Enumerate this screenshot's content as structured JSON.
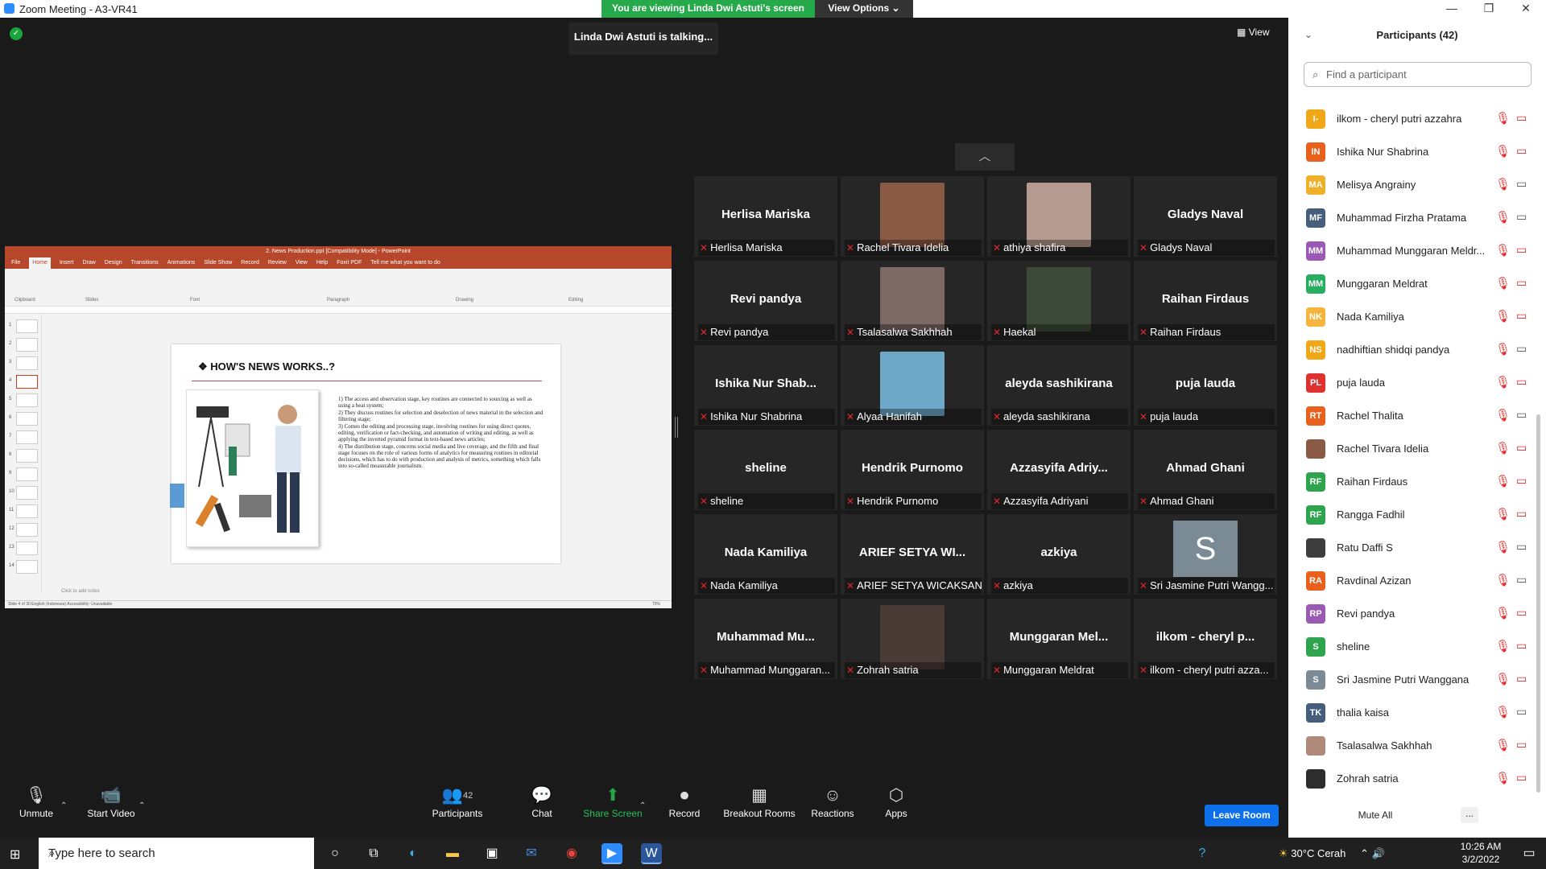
{
  "window": {
    "title": "Zoom Meeting - A3-VR41"
  },
  "banner": {
    "text": "You are viewing Linda Dwi Astuti's screen",
    "view_options": "View Options"
  },
  "talking": "Linda Dwi Astuti is talking...",
  "view_button": "View",
  "shared_screen": {
    "window_title": "2. News Production.ppt [Compatibility Mode] - PowerPoint",
    "tabs": [
      "File",
      "Home",
      "Insert",
      "Draw",
      "Design",
      "Transitions",
      "Animations",
      "Slide Show",
      "Record",
      "Review",
      "View",
      "Help",
      "Foxit PDF",
      "Tell me what you want to do"
    ],
    "ribbon_groups": [
      "Clipboard",
      "Slides",
      "Font",
      "Paragraph",
      "Drawing",
      "Editing"
    ],
    "slide_title": "HOW'S NEWS WORKS..?",
    "slide_points": [
      "1) The access and observation stage, key routines are connected to sourcing as well as using a beat system;",
      "2) They discuss routines for selection and deselection of news material in the selection and filtering stage;",
      "3) Comes the editing and processing stage, involving routines for using direct quotes, editing, verification or fact-checking, and automation of writing and editing, as well as applying the inverted pyramid format in text-based news articles;",
      "4) The distribution stage, concerns social media and live coverage, and the fifth and final stage focuses on the role of various forms of analytics for measuring routines in editorial decisions, which has to do with production and analysis of metrics, something which falls into so-called measurable journalism."
    ],
    "thumbnail_numbers": [
      "1",
      "2",
      "3",
      "4",
      "5",
      "6",
      "7",
      "8",
      "9",
      "10",
      "11",
      "12",
      "13",
      "14"
    ],
    "notes_placeholder": "Click to add notes",
    "status": "Slide 4 of 30    English (Indonesia)    Accessibility: Unavailable",
    "zoom": "70%"
  },
  "tiles": [
    {
      "display": "Herlisa Mariska",
      "name": "Herlisa Mariska",
      "photo": false
    },
    {
      "display": "",
      "name": "Rachel Tivara Idelia",
      "photo": true,
      "photo_color": "#8a5a44"
    },
    {
      "display": "",
      "name": "athiya shafira",
      "photo": true,
      "photo_color": "#b59a8f"
    },
    {
      "display": "Gladys Naval",
      "name": "Gladys Naval",
      "photo": false
    },
    {
      "display": "Revi pandya",
      "name": "Revi pandya",
      "photo": false
    },
    {
      "display": "",
      "name": "Tsalasalwa Sakhhah",
      "photo": true,
      "photo_color": "#7d6a66"
    },
    {
      "display": "",
      "name": "Haekal",
      "photo": true,
      "photo_color": "#3d4a3a"
    },
    {
      "display": "Raihan Firdaus",
      "name": "Raihan Firdaus",
      "photo": false
    },
    {
      "display": "Ishika Nur Shab...",
      "name": "Ishika Nur Shabrina",
      "photo": false
    },
    {
      "display": "",
      "name": "Alyaa Hanifah",
      "photo": true,
      "photo_color": "#6fa9c9"
    },
    {
      "display": "aleyda sashikirana",
      "name": "aleyda sashikirana",
      "photo": false
    },
    {
      "display": "puja lauda",
      "name": "puja lauda",
      "photo": false
    },
    {
      "display": "sheline",
      "name": "sheline",
      "photo": false
    },
    {
      "display": "Hendrik Purnomo",
      "name": "Hendrik Purnomo",
      "photo": false
    },
    {
      "display": "Azzasyifa Adriy...",
      "name": "Azzasyifa Adriyani",
      "photo": false
    },
    {
      "display": "Ahmad Ghani",
      "name": "Ahmad Ghani",
      "photo": false
    },
    {
      "display": "Nada Kamiliya",
      "name": "Nada Kamiliya",
      "photo": false
    },
    {
      "display": "ARIEF SETYA WI...",
      "name": "ARIEF SETYA WICAKSANA",
      "photo": false
    },
    {
      "display": "azkiya",
      "name": "azkiya",
      "photo": false
    },
    {
      "display": "",
      "name": "Sri Jasmine Putri Wangg...",
      "photo": false,
      "avatar_letter": "S"
    },
    {
      "display": "Muhammad Mu...",
      "name": "Muhammad Munggaran...",
      "photo": false
    },
    {
      "display": "",
      "name": "Zohrah satria",
      "photo": true,
      "photo_color": "#4a3b37"
    },
    {
      "display": "Munggaran Mel...",
      "name": "Munggaran Meldrat",
      "photo": false
    },
    {
      "display": "ilkom - cheryl p...",
      "name": "ilkom - cheryl putri azza...",
      "photo": false
    }
  ],
  "panel": {
    "title": "Participants (42)",
    "search_placeholder": "Find a participant",
    "participants": [
      {
        "initials": "I-",
        "name": "ilkom - cheryl putri azzahra",
        "color": "#f0a818",
        "video": false
      },
      {
        "initials": "IN",
        "name": "Ishika Nur Shabrina",
        "color": "#e8601c",
        "video": false
      },
      {
        "initials": "MA",
        "name": "Melisya Angrainy",
        "color": "#f0b12a",
        "video": true
      },
      {
        "initials": "MF",
        "name": "Muhammad Firzha Pratama",
        "color": "#445e7c",
        "video": true
      },
      {
        "initials": "MM",
        "name": "Muhammad Munggaran Meldr...",
        "color": "#9b59b6",
        "video": false
      },
      {
        "initials": "MM",
        "name": "Munggaran Meldrat",
        "color": "#27ae60",
        "video": false
      },
      {
        "initials": "NK",
        "name": "Nada Kamiliya",
        "color": "#f5b53c",
        "video": false
      },
      {
        "initials": "NS",
        "name": "nadhiftian shidqi pandya",
        "color": "#f0a818",
        "video": true
      },
      {
        "initials": "PL",
        "name": "puja lauda",
        "color": "#e03131",
        "video": false
      },
      {
        "initials": "RT",
        "name": "Rachel Thalita",
        "color": "#e8601c",
        "video": true
      },
      {
        "initials": "",
        "name": "Rachel Tivara Idelia",
        "color": "#8a5a44",
        "video": false
      },
      {
        "initials": "RF",
        "name": "Raihan Firdaus",
        "color": "#2ea44f",
        "video": false
      },
      {
        "initials": "RF",
        "name": "Rangga Fadhil",
        "color": "#2ea44f",
        "video": false
      },
      {
        "initials": "",
        "name": "Ratu Daffi S",
        "color": "#3d3d3d",
        "video": true
      },
      {
        "initials": "RA",
        "name": "Ravdinal Azizan",
        "color": "#e8601c",
        "video": true
      },
      {
        "initials": "RP",
        "name": "Revi pandya",
        "color": "#9b59b6",
        "video": false
      },
      {
        "initials": "S",
        "name": "sheline",
        "color": "#2ea44f",
        "video": false
      },
      {
        "initials": "S",
        "name": "Sri Jasmine Putri Wanggana",
        "color": "#7a8b96",
        "video": false
      },
      {
        "initials": "TK",
        "name": "thalia kaisa",
        "color": "#445e7c",
        "video": true
      },
      {
        "initials": "",
        "name": "Tsalasalwa Sakhhah",
        "color": "#b08a78",
        "video": false
      },
      {
        "initials": "",
        "name": "Zohrah satria",
        "color": "#2d2d2d",
        "video": false
      }
    ],
    "mute_all": "Mute All",
    "more": "..."
  },
  "toolbar": {
    "unmute": "Unmute",
    "start_video": "Start Video",
    "participants": "Participants",
    "participants_count": "42",
    "chat": "Chat",
    "share_screen": "Share Screen",
    "record": "Record",
    "breakout_rooms": "Breakout Rooms",
    "reactions": "Reactions",
    "apps": "Apps",
    "leave": "Leave Room"
  },
  "taskbar": {
    "search_placeholder": "Type here to search",
    "weather": "30°C  Cerah",
    "time": "10:26 AM",
    "date": "3/2/2022"
  }
}
